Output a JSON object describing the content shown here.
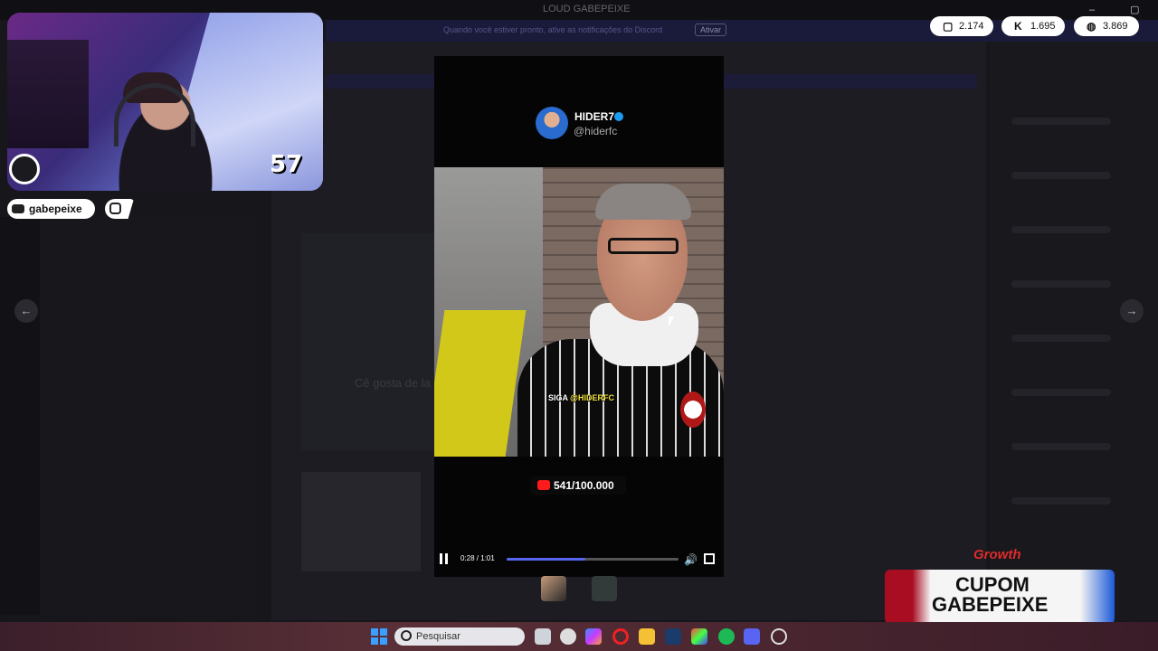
{
  "window": {
    "title": "LOUD GABEPEIXE"
  },
  "banner": {
    "text": "Quando você estiver pronto, ative as notificações do Discord",
    "button": "Ativar"
  },
  "webcam": {
    "counter": "57"
  },
  "socials": {
    "youtube_handle": "gabepeixe"
  },
  "stats": [
    {
      "icon": "twitch-icon",
      "value": "2.174"
    },
    {
      "icon": "kick-icon",
      "glyph": "K",
      "value": "1.695"
    },
    {
      "icon": "globe-icon",
      "value": "3.869"
    }
  ],
  "viewer": {
    "author_name": "HIDER7",
    "author_handle": "@hiderfc",
    "caption_prefix": "SIGA ",
    "caption_highlight": "@HIDERFC",
    "yt_counter": "541/100.000",
    "time": "0:28 / 1:01",
    "progress": 0.46,
    "bg_text": "Cê gosta de la"
  },
  "taskbar": {
    "search_placeholder": "Pesquisar"
  },
  "sponsor": {
    "brand": "Growth",
    "line1": "CUPOM",
    "line2": "GABEPEIXE"
  },
  "colors": {
    "accent": "#5865f2",
    "youtube": "#ff1b1b",
    "verified": "#1d9bf0"
  }
}
